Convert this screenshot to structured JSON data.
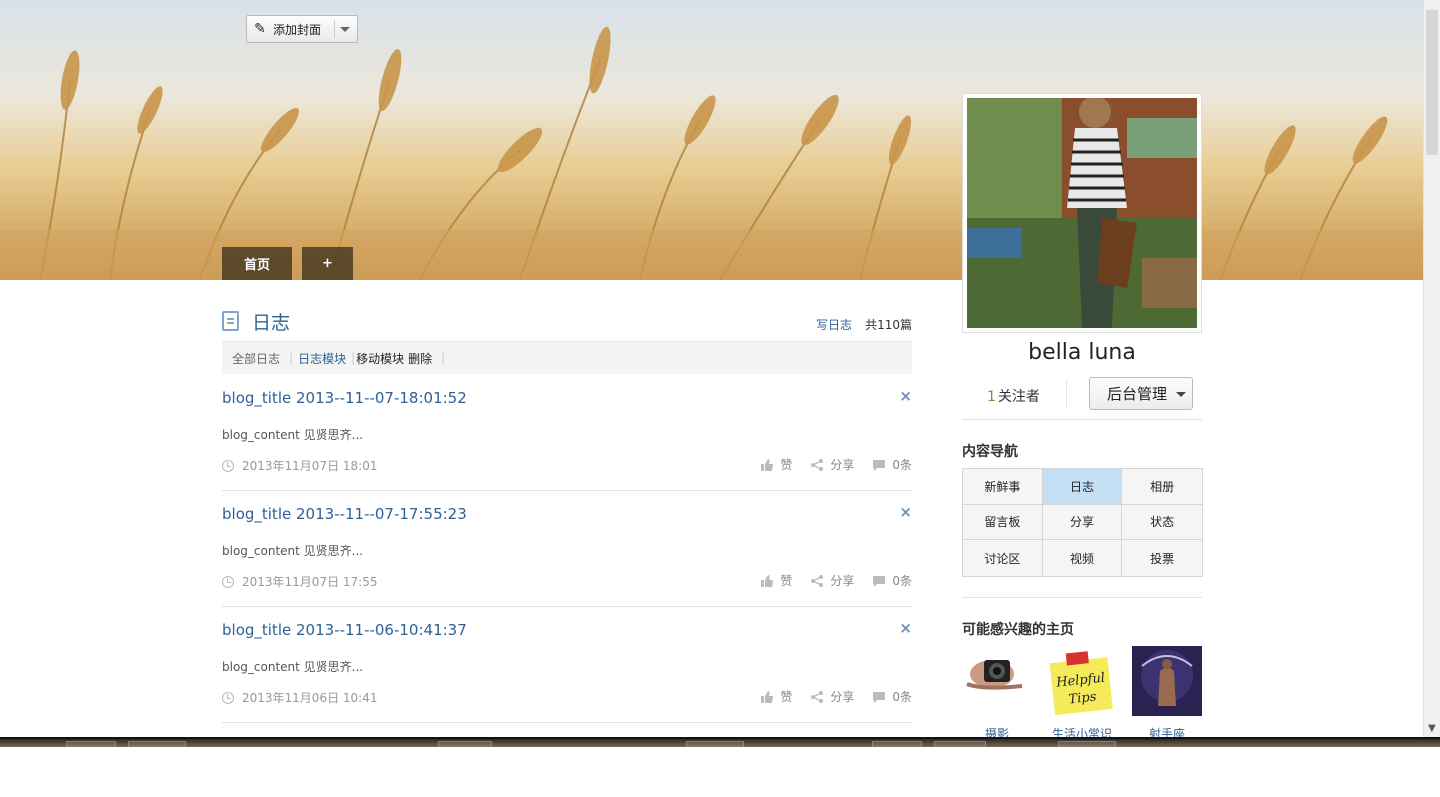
{
  "cover": {
    "add_cover_label": "添加封面"
  },
  "nav_tabs": [
    "首页",
    "+"
  ],
  "blog": {
    "section_title": "日志",
    "write_label": "写日志",
    "total_label": "共110篇",
    "toolbar": {
      "all_label": "全部日志",
      "module_label": "日志模块",
      "move_label": "移动模块",
      "delete_label": "删除"
    },
    "posts": [
      {
        "title": "blog_title 2013--11--07-18:01:52",
        "content": "blog_content 见贤思齐...",
        "time": "2013年11月07日 18:01",
        "like": "赞",
        "share": "分享",
        "comments": "0条"
      },
      {
        "title": "blog_title 2013--11--07-17:55:23",
        "content": "blog_content 见贤思齐...",
        "time": "2013年11月07日 17:55",
        "like": "赞",
        "share": "分享",
        "comments": "0条"
      },
      {
        "title": "blog_title 2013--11--06-10:41:37",
        "content": "blog_content 见贤思齐...",
        "time": "2013年11月06日 10:41",
        "like": "赞",
        "share": "分享",
        "comments": "0条"
      }
    ]
  },
  "profile": {
    "name": "bella luna",
    "followers_count": "1",
    "followers_label": "关注者",
    "admin_label": "后台管理"
  },
  "content_nav": {
    "title": "内容导航",
    "items": [
      "新鲜事",
      "日志",
      "相册",
      "留言板",
      "分享",
      "状态",
      "讨论区",
      "视频",
      "投票"
    ],
    "active": "日志"
  },
  "recommend": {
    "title": "可能感兴趣的主页",
    "items": [
      {
        "label": "摄影",
        "icon": "camera-photographer-thumbnail"
      },
      {
        "label": "生活小常识",
        "icon": "helpful-tips-note-thumbnail"
      },
      {
        "label": "射手座",
        "icon": "sagittarius-archer-thumbnail"
      }
    ]
  },
  "colors": {
    "link": "#2e5f95",
    "active_nav": "#c5e0f5",
    "follower_count": "#6a9a2e"
  }
}
